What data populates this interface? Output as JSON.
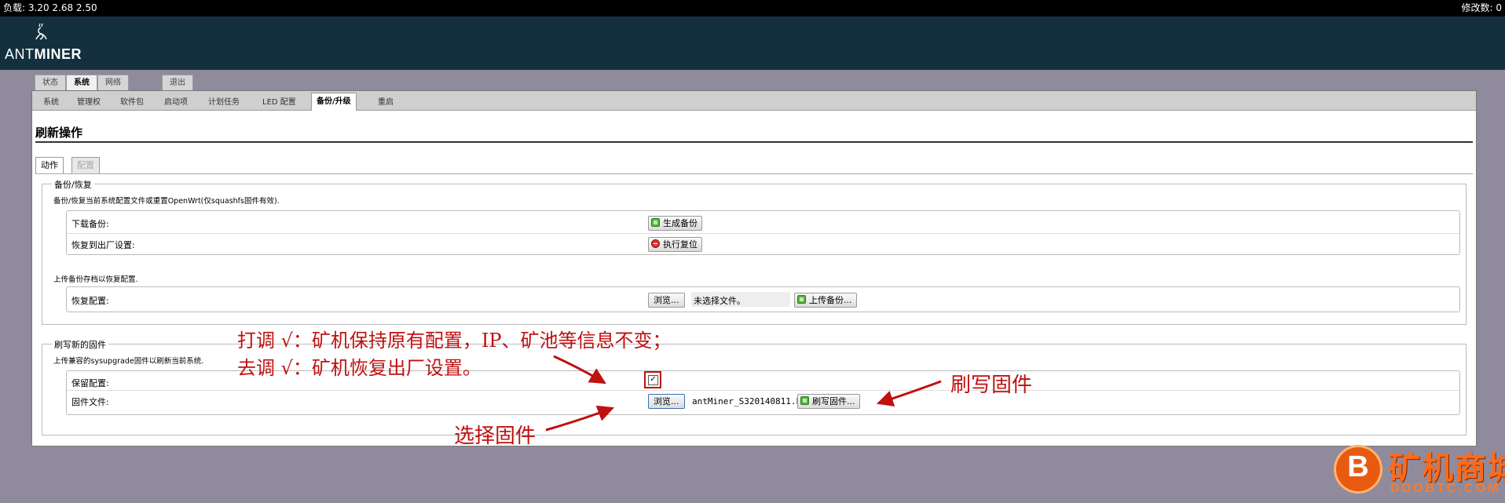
{
  "topbar": {
    "load": "负载: 3.20 2.68 2.50",
    "changes": "修改数: 0"
  },
  "logo": {
    "text_light": "ANT",
    "text_bold": "MINER"
  },
  "main_tabs": [
    "状态",
    "系统",
    "网络",
    "退出"
  ],
  "main_tabs_active": "系统",
  "sub_tabs": [
    "系统",
    "管理权",
    "软件包",
    "启动项",
    "计划任务",
    "LED 配置",
    "备份/升级",
    "重启"
  ],
  "sub_tabs_active": "备份/升级",
  "page_title": "刷新操作",
  "content_tabs": {
    "action": "动作",
    "config": "配置"
  },
  "backup": {
    "legend": "备份/恢复",
    "description": "备份/恢复当前系统配置文件或重置OpenWrt(仅squashfs固件有效).",
    "download_label": "下载备份:",
    "generate_button": "生成备份",
    "reset_label": "恢复到出厂设置:",
    "reset_button": "执行复位",
    "upload_description": "上传备份存档以恢复配置.",
    "restore_label": "恢复配置:",
    "browse_button": "浏览...",
    "no_file": "未选择文件。",
    "upload_button": "上传备份..."
  },
  "firmware": {
    "legend": "刷写新的固件",
    "description": "上传兼容的sysupgrade固件以刷新当前系统.",
    "keep_label": "保留配置:",
    "keep_checked": true,
    "file_label": "固件文件:",
    "browse_button": "浏览...",
    "file_name": "antMiner_S320140811.bin",
    "flash_button": "刷写固件..."
  },
  "annotations": {
    "line1": "打调 √：矿机保持原有配置，IP、矿池等信息不变；",
    "line2": "去调 √：矿机恢复出厂设置。",
    "flash": "刷写固件",
    "choose": "选择固件"
  },
  "watermark": {
    "main": "矿机商城",
    "sub": "DDOBTC.COM",
    "badge": "B"
  },
  "colors": {
    "annotation": "#c01010",
    "header": "#14303f",
    "background": "#8f8b9c",
    "watermark": "#ff6a1a"
  }
}
